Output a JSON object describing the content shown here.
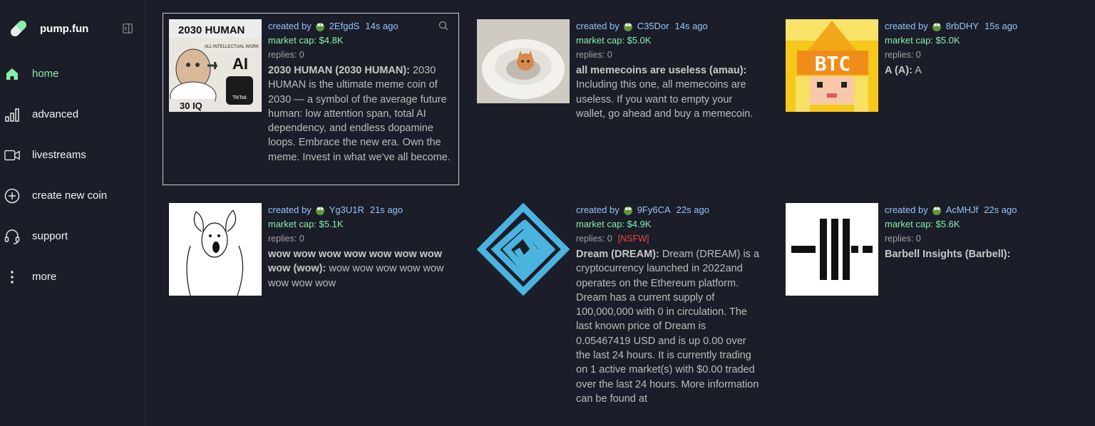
{
  "brand": {
    "name": "pump.fun"
  },
  "nav": [
    {
      "label": "home",
      "icon": "home-icon",
      "active": true
    },
    {
      "label": "advanced",
      "icon": "chart-icon"
    },
    {
      "label": "livestreams",
      "icon": "video-icon"
    },
    {
      "label": "create new coin",
      "icon": "plus-circle-icon"
    },
    {
      "label": "support",
      "icon": "headset-icon"
    },
    {
      "label": "more",
      "icon": "more-icon"
    }
  ],
  "colors": {
    "background": "#1b1d28",
    "accent_green": "#86efac",
    "accent_blue": "#93c5fd",
    "nsfw_red": "#ef4444"
  },
  "coins": [
    {
      "created_by": "created by",
      "creator": "2EfgdS",
      "age": "14s ago",
      "market_cap": "market cap: $4.8K",
      "replies": "replies: 0",
      "name": "2030 HUMAN (2030 HUMAN):",
      "description": " 2030 HUMAN is the ultimate meme coin of 2030 — a symbol of the average future human: low attention span, total AI dependency, and endless dopamine loops. Embrace the new era. Own the meme. Invest in what we've all become.",
      "thumb": {
        "title": "2030 HUMAN",
        "sub": "ALL INTELLECTUAL WORK",
        "ai": "AI",
        "iq": "30 IQ",
        "app": "TikTok"
      }
    },
    {
      "created_by": "created by",
      "creator": "C35Dor",
      "age": "14s ago",
      "market_cap": "market cap: $5.0K",
      "replies": "replies: 0",
      "name": "all memecoins are useless (amau):",
      "description": " Including this one, all memecoins are useless. If you want to empty your wallet, go ahead and buy a memecoin."
    },
    {
      "created_by": "created by",
      "creator": "8rbDHY",
      "age": "15s ago",
      "market_cap": "market cap: $5.0K",
      "replies": "replies: 0",
      "name": "A (A):",
      "description": " A",
      "thumb": {
        "text": "BTC"
      }
    },
    {
      "created_by": "created by",
      "creator": "Yg3U1R",
      "age": "21s ago",
      "market_cap": "market cap: $5.1K",
      "replies": "replies: 0",
      "name": "wow wow wow wow wow wow wow wow (wow):",
      "description": " wow wow wow wow wow wow wow wow"
    },
    {
      "created_by": "created by",
      "creator": "9Fy6CA",
      "age": "22s ago",
      "market_cap": "market cap: $4.9K",
      "replies": "replies: 0",
      "nsfw": "[NSFW]",
      "name": "Dream (DREAM):",
      "description": " Dream (DREAM) is a cryptocurrency launched in 2022and operates on the Ethereum platform. Dream has a current supply of 100,000,000 with 0 in circulation. The last known price of Dream is 0.05467419 USD and is up 0.00 over the last 24 hours. It is currently trading on 1 active market(s) with $0.00 traded over the last 24 hours. More information can be found at https://thedreamchain.com"
    },
    {
      "created_by": "created by",
      "creator": "AcMHJf",
      "age": "22s ago",
      "market_cap": "market cap: $5.6K",
      "replies": "replies: 0",
      "name": "Barbell Insights (Barbell):",
      "description": ""
    }
  ]
}
